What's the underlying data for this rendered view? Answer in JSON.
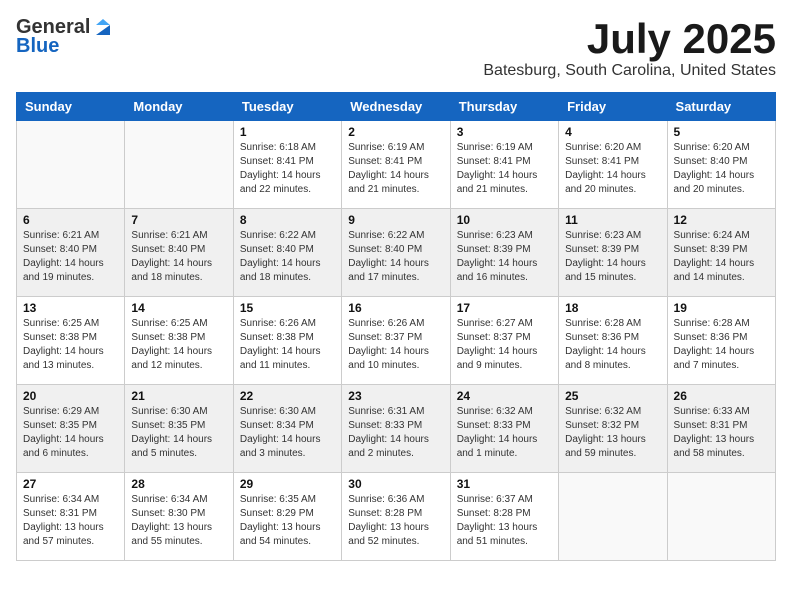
{
  "logo": {
    "general": "General",
    "blue": "Blue"
  },
  "title": "July 2025",
  "location": "Batesburg, South Carolina, United States",
  "days_of_week": [
    "Sunday",
    "Monday",
    "Tuesday",
    "Wednesday",
    "Thursday",
    "Friday",
    "Saturday"
  ],
  "weeks": [
    [
      {
        "day": "",
        "sunrise": "",
        "sunset": "",
        "daylight": ""
      },
      {
        "day": "",
        "sunrise": "",
        "sunset": "",
        "daylight": ""
      },
      {
        "day": "1",
        "sunrise": "Sunrise: 6:18 AM",
        "sunset": "Sunset: 8:41 PM",
        "daylight": "Daylight: 14 hours and 22 minutes."
      },
      {
        "day": "2",
        "sunrise": "Sunrise: 6:19 AM",
        "sunset": "Sunset: 8:41 PM",
        "daylight": "Daylight: 14 hours and 21 minutes."
      },
      {
        "day": "3",
        "sunrise": "Sunrise: 6:19 AM",
        "sunset": "Sunset: 8:41 PM",
        "daylight": "Daylight: 14 hours and 21 minutes."
      },
      {
        "day": "4",
        "sunrise": "Sunrise: 6:20 AM",
        "sunset": "Sunset: 8:41 PM",
        "daylight": "Daylight: 14 hours and 20 minutes."
      },
      {
        "day": "5",
        "sunrise": "Sunrise: 6:20 AM",
        "sunset": "Sunset: 8:40 PM",
        "daylight": "Daylight: 14 hours and 20 minutes."
      }
    ],
    [
      {
        "day": "6",
        "sunrise": "Sunrise: 6:21 AM",
        "sunset": "Sunset: 8:40 PM",
        "daylight": "Daylight: 14 hours and 19 minutes."
      },
      {
        "day": "7",
        "sunrise": "Sunrise: 6:21 AM",
        "sunset": "Sunset: 8:40 PM",
        "daylight": "Daylight: 14 hours and 18 minutes."
      },
      {
        "day": "8",
        "sunrise": "Sunrise: 6:22 AM",
        "sunset": "Sunset: 8:40 PM",
        "daylight": "Daylight: 14 hours and 18 minutes."
      },
      {
        "day": "9",
        "sunrise": "Sunrise: 6:22 AM",
        "sunset": "Sunset: 8:40 PM",
        "daylight": "Daylight: 14 hours and 17 minutes."
      },
      {
        "day": "10",
        "sunrise": "Sunrise: 6:23 AM",
        "sunset": "Sunset: 8:39 PM",
        "daylight": "Daylight: 14 hours and 16 minutes."
      },
      {
        "day": "11",
        "sunrise": "Sunrise: 6:23 AM",
        "sunset": "Sunset: 8:39 PM",
        "daylight": "Daylight: 14 hours and 15 minutes."
      },
      {
        "day": "12",
        "sunrise": "Sunrise: 6:24 AM",
        "sunset": "Sunset: 8:39 PM",
        "daylight": "Daylight: 14 hours and 14 minutes."
      }
    ],
    [
      {
        "day": "13",
        "sunrise": "Sunrise: 6:25 AM",
        "sunset": "Sunset: 8:38 PM",
        "daylight": "Daylight: 14 hours and 13 minutes."
      },
      {
        "day": "14",
        "sunrise": "Sunrise: 6:25 AM",
        "sunset": "Sunset: 8:38 PM",
        "daylight": "Daylight: 14 hours and 12 minutes."
      },
      {
        "day": "15",
        "sunrise": "Sunrise: 6:26 AM",
        "sunset": "Sunset: 8:38 PM",
        "daylight": "Daylight: 14 hours and 11 minutes."
      },
      {
        "day": "16",
        "sunrise": "Sunrise: 6:26 AM",
        "sunset": "Sunset: 8:37 PM",
        "daylight": "Daylight: 14 hours and 10 minutes."
      },
      {
        "day": "17",
        "sunrise": "Sunrise: 6:27 AM",
        "sunset": "Sunset: 8:37 PM",
        "daylight": "Daylight: 14 hours and 9 minutes."
      },
      {
        "day": "18",
        "sunrise": "Sunrise: 6:28 AM",
        "sunset": "Sunset: 8:36 PM",
        "daylight": "Daylight: 14 hours and 8 minutes."
      },
      {
        "day": "19",
        "sunrise": "Sunrise: 6:28 AM",
        "sunset": "Sunset: 8:36 PM",
        "daylight": "Daylight: 14 hours and 7 minutes."
      }
    ],
    [
      {
        "day": "20",
        "sunrise": "Sunrise: 6:29 AM",
        "sunset": "Sunset: 8:35 PM",
        "daylight": "Daylight: 14 hours and 6 minutes."
      },
      {
        "day": "21",
        "sunrise": "Sunrise: 6:30 AM",
        "sunset": "Sunset: 8:35 PM",
        "daylight": "Daylight: 14 hours and 5 minutes."
      },
      {
        "day": "22",
        "sunrise": "Sunrise: 6:30 AM",
        "sunset": "Sunset: 8:34 PM",
        "daylight": "Daylight: 14 hours and 3 minutes."
      },
      {
        "day": "23",
        "sunrise": "Sunrise: 6:31 AM",
        "sunset": "Sunset: 8:33 PM",
        "daylight": "Daylight: 14 hours and 2 minutes."
      },
      {
        "day": "24",
        "sunrise": "Sunrise: 6:32 AM",
        "sunset": "Sunset: 8:33 PM",
        "daylight": "Daylight: 14 hours and 1 minute."
      },
      {
        "day": "25",
        "sunrise": "Sunrise: 6:32 AM",
        "sunset": "Sunset: 8:32 PM",
        "daylight": "Daylight: 13 hours and 59 minutes."
      },
      {
        "day": "26",
        "sunrise": "Sunrise: 6:33 AM",
        "sunset": "Sunset: 8:31 PM",
        "daylight": "Daylight: 13 hours and 58 minutes."
      }
    ],
    [
      {
        "day": "27",
        "sunrise": "Sunrise: 6:34 AM",
        "sunset": "Sunset: 8:31 PM",
        "daylight": "Daylight: 13 hours and 57 minutes."
      },
      {
        "day": "28",
        "sunrise": "Sunrise: 6:34 AM",
        "sunset": "Sunset: 8:30 PM",
        "daylight": "Daylight: 13 hours and 55 minutes."
      },
      {
        "day": "29",
        "sunrise": "Sunrise: 6:35 AM",
        "sunset": "Sunset: 8:29 PM",
        "daylight": "Daylight: 13 hours and 54 minutes."
      },
      {
        "day": "30",
        "sunrise": "Sunrise: 6:36 AM",
        "sunset": "Sunset: 8:28 PM",
        "daylight": "Daylight: 13 hours and 52 minutes."
      },
      {
        "day": "31",
        "sunrise": "Sunrise: 6:37 AM",
        "sunset": "Sunset: 8:28 PM",
        "daylight": "Daylight: 13 hours and 51 minutes."
      },
      {
        "day": "",
        "sunrise": "",
        "sunset": "",
        "daylight": ""
      },
      {
        "day": "",
        "sunrise": "",
        "sunset": "",
        "daylight": ""
      }
    ]
  ]
}
